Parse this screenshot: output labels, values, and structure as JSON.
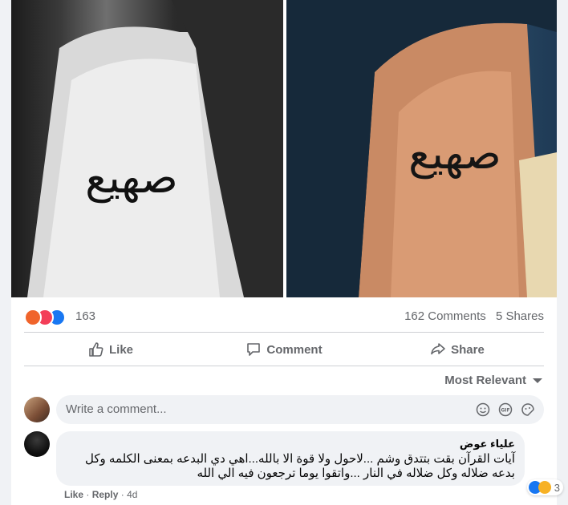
{
  "post": {
    "reaction_count": "163",
    "comments": "162 Comments",
    "shares": "5 Shares",
    "reaction_colors": [
      "#f0642b",
      "#f33e58",
      "#1877f2"
    ]
  },
  "actions": {
    "like": "Like",
    "comment": "Comment",
    "share": "Share"
  },
  "sort": {
    "label": "Most Relevant"
  },
  "composer": {
    "placeholder": "Write a comment..."
  },
  "comment": {
    "author": "علياء عوض",
    "text": "آيات القرآن بقت بتتدق وشم ...لاحول ولا قوة الا بالله...اهي دي البدعه بمعنى الكلمه وكل بدعه ضلاله وكل ضلاله في النار ...واتقوا يوما ترجعون فيه الي الله",
    "reaction_count": "3",
    "like": "Like",
    "reply": "Reply",
    "time": "4d"
  },
  "tattoo_text": "صهيع"
}
